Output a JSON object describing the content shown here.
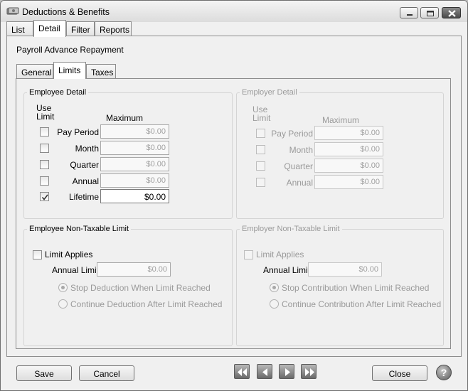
{
  "window": {
    "title": "Deductions & Benefits",
    "icon": "money-icon"
  },
  "main_tabs": [
    {
      "label": "List",
      "active": false
    },
    {
      "label": "Detail",
      "active": true
    },
    {
      "label": "Filter",
      "active": false
    },
    {
      "label": "Reports",
      "active": false
    }
  ],
  "record_title": "Payroll Advance Repayment",
  "sub_tabs": [
    {
      "label": "General",
      "active": false
    },
    {
      "label": "Limits",
      "active": true
    },
    {
      "label": "Taxes",
      "active": false
    }
  ],
  "employee_detail": {
    "title": "Employee Detail",
    "use_limit_header_line1": "Use",
    "use_limit_header_line2": "Limit",
    "maximum_header": "Maximum",
    "rows": [
      {
        "label": "Pay Period",
        "checked": false,
        "value": "$0.00"
      },
      {
        "label": "Month",
        "checked": false,
        "value": "$0.00"
      },
      {
        "label": "Quarter",
        "checked": false,
        "value": "$0.00"
      },
      {
        "label": "Annual",
        "checked": false,
        "value": "$0.00"
      },
      {
        "label": "Lifetime",
        "checked": true,
        "value": "$0.00"
      }
    ]
  },
  "employer_detail": {
    "title": "Employer Detail",
    "use_limit_header_line1": "Use",
    "use_limit_header_line2": "Limit",
    "maximum_header": "Maximum",
    "rows": [
      {
        "label": "Pay Period",
        "checked": false,
        "value": "$0.00"
      },
      {
        "label": "Month",
        "checked": false,
        "value": "$0.00"
      },
      {
        "label": "Quarter",
        "checked": false,
        "value": "$0.00"
      },
      {
        "label": "Annual",
        "checked": false,
        "value": "$0.00"
      }
    ]
  },
  "employee_nontaxable": {
    "title": "Employee Non-Taxable Limit",
    "limit_applies_label": "Limit Applies",
    "annual_limit_label": "Annual Limit",
    "annual_limit_value": "$0.00",
    "option_stop": "Stop Deduction When Limit Reached",
    "option_continue": "Continue Deduction After Limit Reached"
  },
  "employer_nontaxable": {
    "title": "Employer Non-Taxable Limit",
    "limit_applies_label": "Limit Applies",
    "annual_limit_label": "Annual Limit",
    "annual_limit_value": "$0.00",
    "option_stop": "Stop Contribution When Limit Reached",
    "option_continue": "Continue Contribution After Limit Reached"
  },
  "footer": {
    "save_label": "Save",
    "cancel_label": "Cancel",
    "close_label": "Close",
    "help_label": "?"
  }
}
